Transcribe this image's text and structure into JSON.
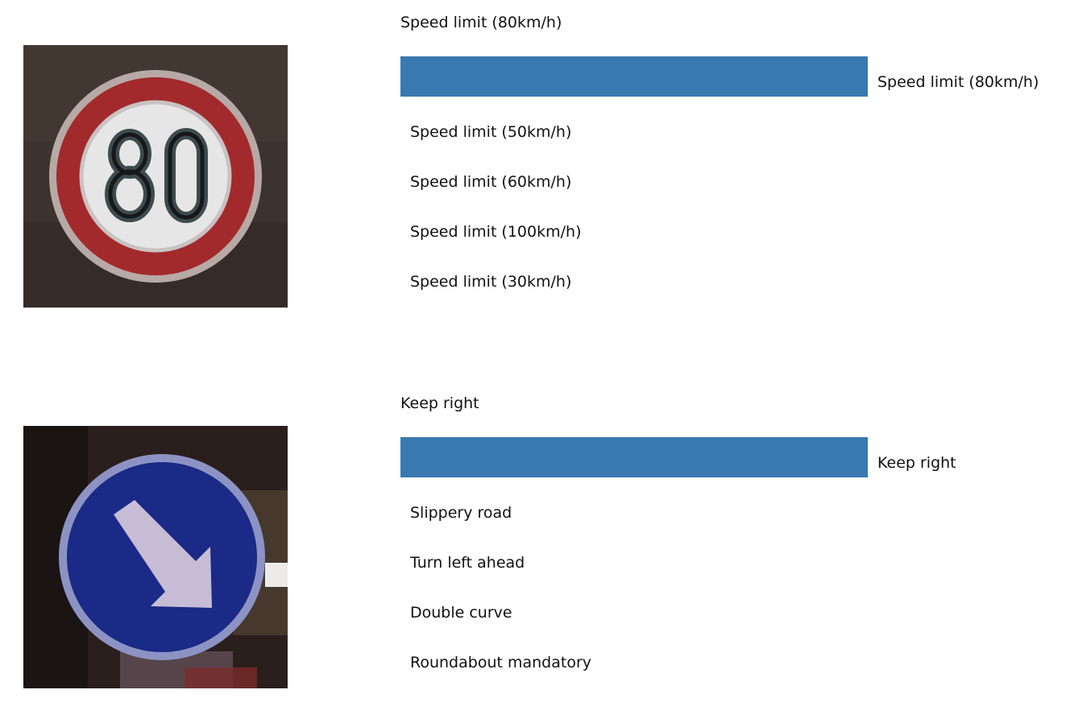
{
  "chart_data": [
    {
      "type": "bar",
      "orientation": "horizontal",
      "title": "Speed limit (80km/h)",
      "image_icon": "speed-limit-80-sign",
      "categories": [
        "Speed limit (80km/h)",
        "Speed limit (50km/h)",
        "Speed limit (60km/h)",
        "Speed limit (100km/h)",
        "Speed limit (30km/h)"
      ],
      "values": [
        1.0,
        0.0,
        0.0,
        0.0,
        0.0
      ],
      "xlim": [
        0,
        1
      ],
      "grid": false,
      "bar_color": "#3a78b0"
    },
    {
      "type": "bar",
      "orientation": "horizontal",
      "title": "Keep right",
      "image_icon": "keep-right-sign",
      "categories": [
        "Keep right",
        "Slippery road",
        "Turn left ahead",
        "Double curve",
        "Roundabout mandatory"
      ],
      "values": [
        1.0,
        0.0,
        0.0,
        0.0,
        0.0
      ],
      "xlim": [
        0,
        1
      ],
      "grid": false,
      "bar_color": "#3a78b0"
    }
  ]
}
